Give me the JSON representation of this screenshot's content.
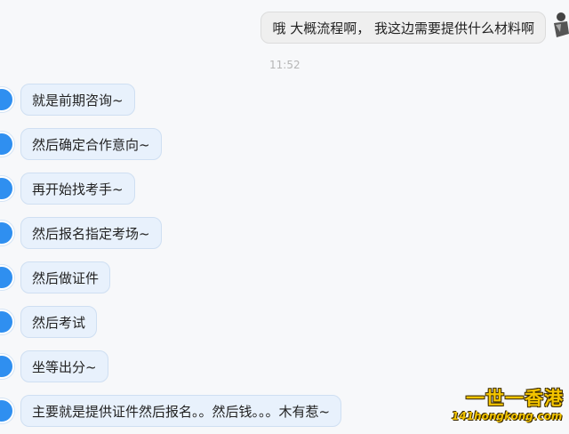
{
  "outgoing": {
    "text": "哦 大概流程啊， 我这边需要提供什么材料啊"
  },
  "timestamp": "11:52",
  "incoming": [
    {
      "text": "就是前期咨询~"
    },
    {
      "text": "然后确定合作意向~"
    },
    {
      "text": "再开始找考手~"
    },
    {
      "text": "然后报名指定考场~"
    },
    {
      "text": "然后做证件"
    },
    {
      "text": "然后考试"
    },
    {
      "text": "坐等出分~"
    },
    {
      "text": "主要就是提供证件然后报名。。然后钱。。。木有惹~"
    }
  ],
  "watermark": {
    "title": "一世一香港",
    "site": "141hongkong.com"
  },
  "colors": {
    "incoming_bubble": "#e8f1fc",
    "outgoing_bubble": "#efefef",
    "avatar": "#2f8ff0",
    "watermark": "#f3c400"
  }
}
